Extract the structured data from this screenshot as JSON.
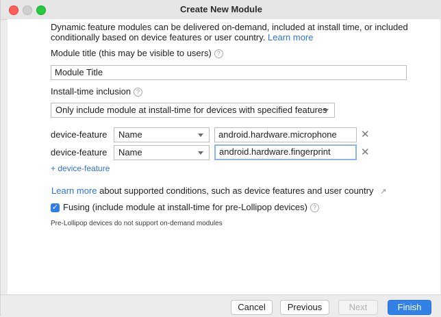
{
  "window": {
    "title": "Create New Module"
  },
  "description": {
    "text": "Dynamic feature modules can be delivered on-demand, included at install time, or included conditionally based on device features or user country.",
    "link": "Learn more"
  },
  "module_title": {
    "label": "Module title (this may be visible to users)",
    "value": "Module Title"
  },
  "install_time": {
    "label": "Install-time inclusion",
    "selected": "Only include module at install-time for devices with specified features"
  },
  "conditions": [
    {
      "label": "device-feature",
      "type": "Name",
      "value": "android.hardware.microphone"
    },
    {
      "label": "device-feature",
      "type": "Name",
      "value": "android.hardware.fingerprint"
    }
  ],
  "add_condition": "+ device-feature",
  "learn_more": {
    "link": "Learn more",
    "text": "about supported conditions, such as device features and user country"
  },
  "fusing": {
    "checked": true,
    "label": "Fusing (include module at install-time for pre-Lollipop devices)"
  },
  "note": "Pre-Lollipop devices do not support on-demand modules",
  "buttons": {
    "cancel": "Cancel",
    "previous": "Previous",
    "next": "Next",
    "finish": "Finish"
  },
  "icons": {
    "help": "help-icon",
    "remove": "close-icon",
    "external": "external-link-icon",
    "dropdown": "chevron-down-icon"
  },
  "colors": {
    "link": "#2f72d6",
    "primary_button": "#3281e6",
    "checkbox": "#2f7ee6"
  }
}
